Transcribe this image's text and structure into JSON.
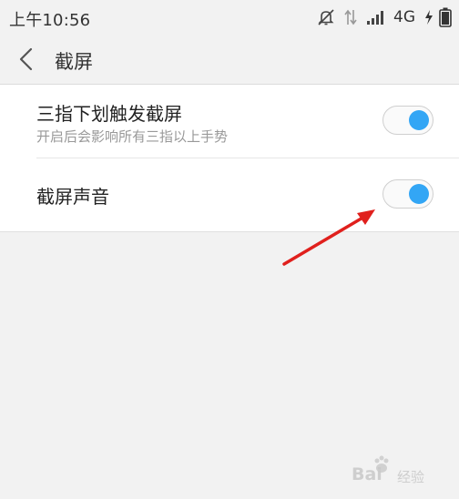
{
  "status_bar": {
    "time": "上午10:56",
    "network": "4G",
    "icons": [
      "mute-icon",
      "data-arrows-icon",
      "signal-icon",
      "charging-icon",
      "battery-icon"
    ]
  },
  "header": {
    "back_icon": "chevron-left-icon",
    "title": "截屏"
  },
  "settings": [
    {
      "label": "三指下划触发截屏",
      "description": "开启后会影响所有三指以上手势",
      "enabled": true
    },
    {
      "label": "截屏声音",
      "enabled": true
    }
  ],
  "colors": {
    "accent": "#33a6f5",
    "arrow": "#e0201d",
    "background": "#f2f2f2"
  },
  "watermark": {
    "brand": "Bai",
    "text": "经验"
  }
}
